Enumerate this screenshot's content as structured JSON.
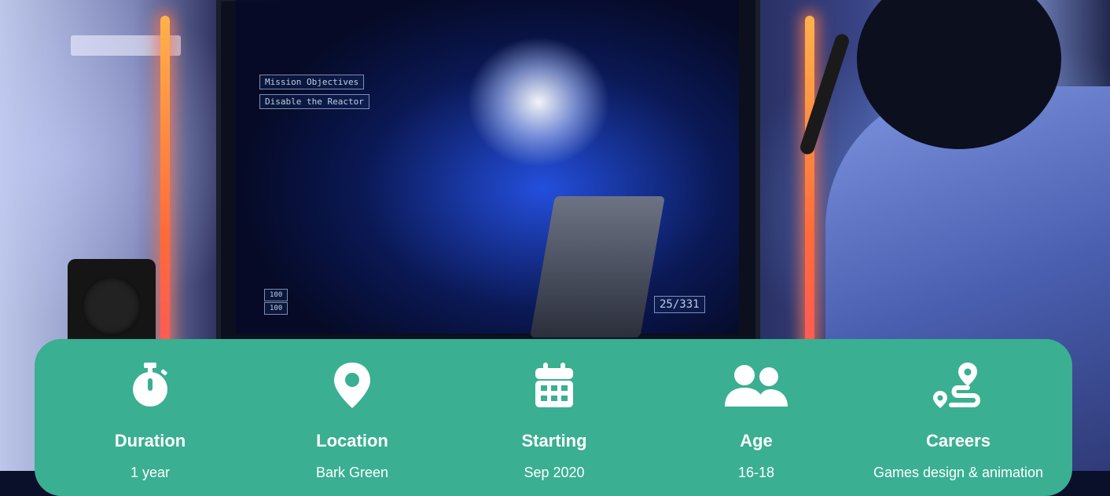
{
  "hero": {
    "hud_objective_title": "Mission Objectives",
    "hud_objective_text": "Disable the Reactor",
    "hud_health_top": "100",
    "hud_health_bottom": "100",
    "hud_ammo": "25/331"
  },
  "info": {
    "background_color": "#3aaf92",
    "text_color": "#ffffff",
    "items": [
      {
        "icon": "stopwatch-icon",
        "label": "Duration",
        "value": "1 year"
      },
      {
        "icon": "map-pin-icon",
        "label": "Location",
        "value": "Bark Green"
      },
      {
        "icon": "calendar-icon",
        "label": "Starting",
        "value": "Sep 2020"
      },
      {
        "icon": "users-icon",
        "label": "Age",
        "value": "16-18"
      },
      {
        "icon": "route-icon",
        "label": "Careers",
        "value": "Games design & animation"
      }
    ]
  }
}
